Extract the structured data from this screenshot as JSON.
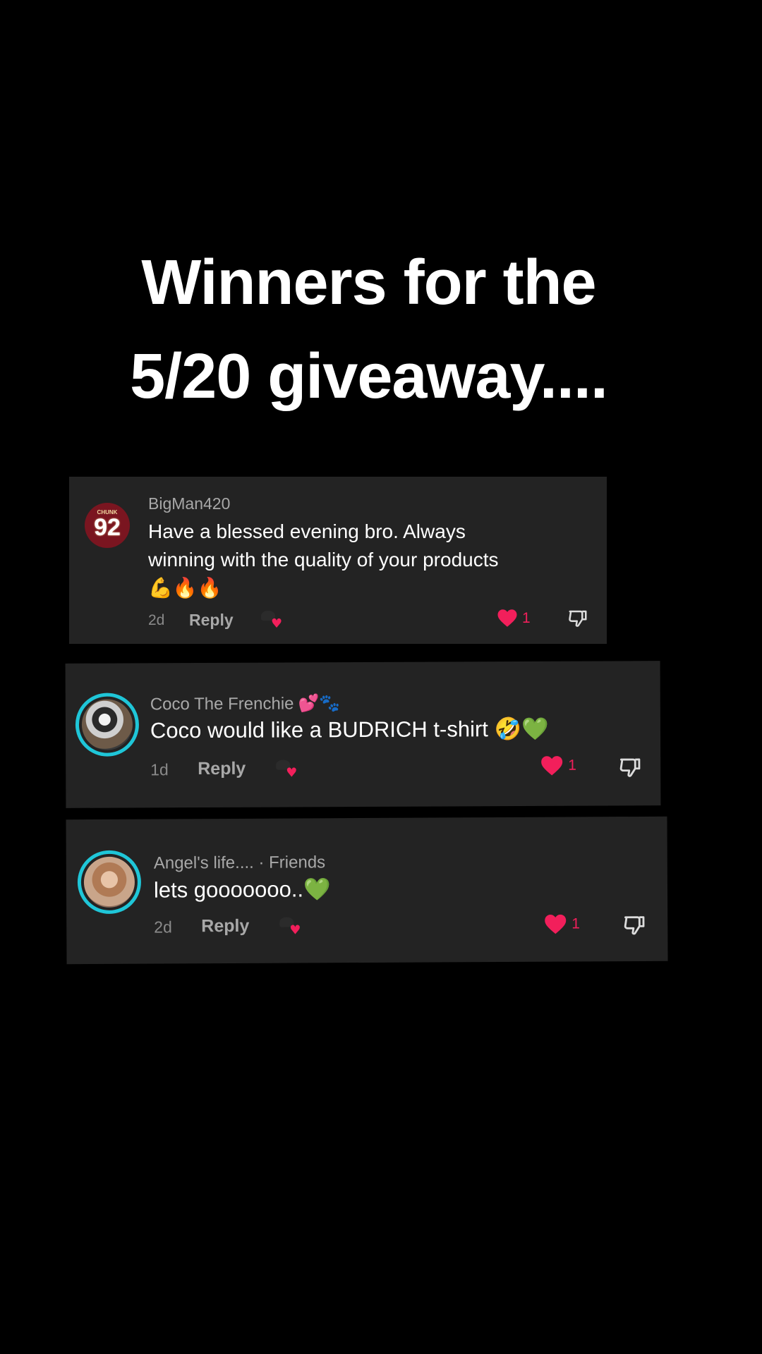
{
  "headline": {
    "line1": "Winners for the",
    "line2": "5/20 giveaway...."
  },
  "comments": [
    {
      "username": "BigMan420",
      "avatar_jersey_label": "CHUNK",
      "avatar_jersey_number": "92",
      "text_lines": [
        "Have a blessed evening bro. Always",
        "winning with the quality of your products",
        "💪🔥🔥"
      ],
      "age": "2d",
      "reply_label": "Reply",
      "like_count": "1"
    },
    {
      "username": "Coco The Frenchie",
      "username_emoji": "💕🐾",
      "text": "Coco would like a BUDRICH t-shirt",
      "text_emoji": "🤣",
      "text_emoji2": "💚",
      "age": "1d",
      "reply_label": "Reply",
      "like_count": "1"
    },
    {
      "username": "Angel's life....",
      "relation": " · Friends",
      "text": "lets gooooooo..",
      "text_emoji": "💚",
      "age": "2d",
      "reply_label": "Reply",
      "like_count": "1"
    }
  ],
  "colors": {
    "background": "#000000",
    "card": "#232323",
    "like_red": "#f21f5b",
    "avatar_ring": "#1fc6d8"
  },
  "icons": [
    "heart-icon",
    "dislike-icon",
    "creator-liked-icon"
  ]
}
